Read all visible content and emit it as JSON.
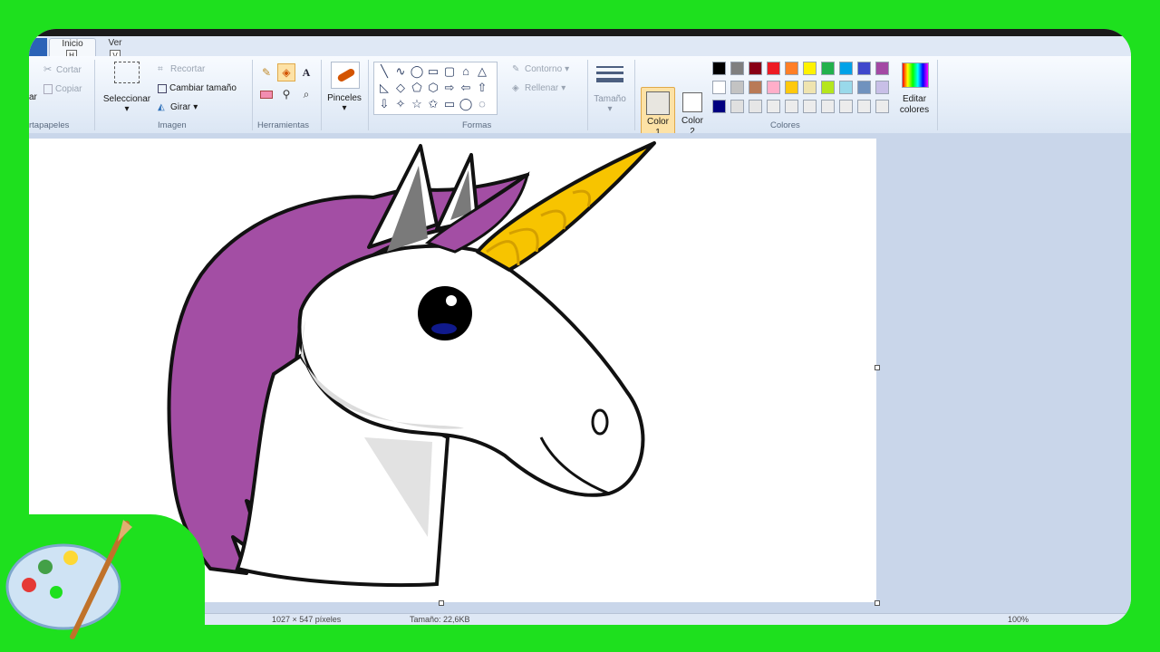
{
  "tabs": [
    {
      "label": "Inicio",
      "keytip": "H"
    },
    {
      "label": "Ver",
      "keytip": "V"
    }
  ],
  "clipboard": {
    "paste_label": "ar",
    "cut_label": "Cortar",
    "copy_label": "Copiar",
    "group_label": "rtapapeles"
  },
  "image": {
    "select_label": "Seleccionar",
    "crop_label": "Recortar",
    "resize_label": "Cambiar tamaño",
    "rotate_label": "Girar",
    "group_label": "Imagen"
  },
  "tools": {
    "group_label": "Herramientas",
    "text_glyph": "A"
  },
  "brushes": {
    "label": "Pinceles"
  },
  "shapes": {
    "outline_label": "Contorno",
    "fill_label": "Rellenar",
    "group_label": "Formas",
    "glyphs": [
      "╲",
      "∿",
      "◯",
      "▭",
      "▢",
      "⌂",
      "△",
      "◺",
      "◇",
      "⬠",
      "⬡",
      "⇨",
      "⇦",
      "⇧",
      "⇩",
      "✧",
      "☆",
      "✩",
      "▭",
      "◯",
      "◌"
    ]
  },
  "size": {
    "label": "Tamaño"
  },
  "color1": {
    "label": "Color",
    "number": "1",
    "value": "#e8e6e0"
  },
  "color2": {
    "label": "Color",
    "number": "2",
    "value": "#ffffff"
  },
  "colors": {
    "group_label": "Colores",
    "edit_label_1": "Editar",
    "edit_label_2": "colores",
    "row1": [
      "#000000",
      "#7f7f7f",
      "#880015",
      "#ed1c24",
      "#ff7f27",
      "#fff200",
      "#22b14c",
      "#00a2e8",
      "#3f48cc",
      "#a349a4"
    ],
    "row2": [
      "#ffffff",
      "#c3c3c3",
      "#b97a57",
      "#ffaec9",
      "#ffc90e",
      "#efe4b0",
      "#b5e61d",
      "#99d9ea",
      "#7092be",
      "#c8bfe7"
    ],
    "row3": [
      "#000080",
      "#e0e0e0",
      "#e6e6e6",
      "#ececec",
      "#ececec",
      "#ececec",
      "#ececec",
      "#ececec",
      "#ececec",
      "#ececec"
    ]
  },
  "status": {
    "dimensions": "1027 × 547 píxeles",
    "filesize": "Tamaño: 22,6KB",
    "zoom": "100%"
  }
}
